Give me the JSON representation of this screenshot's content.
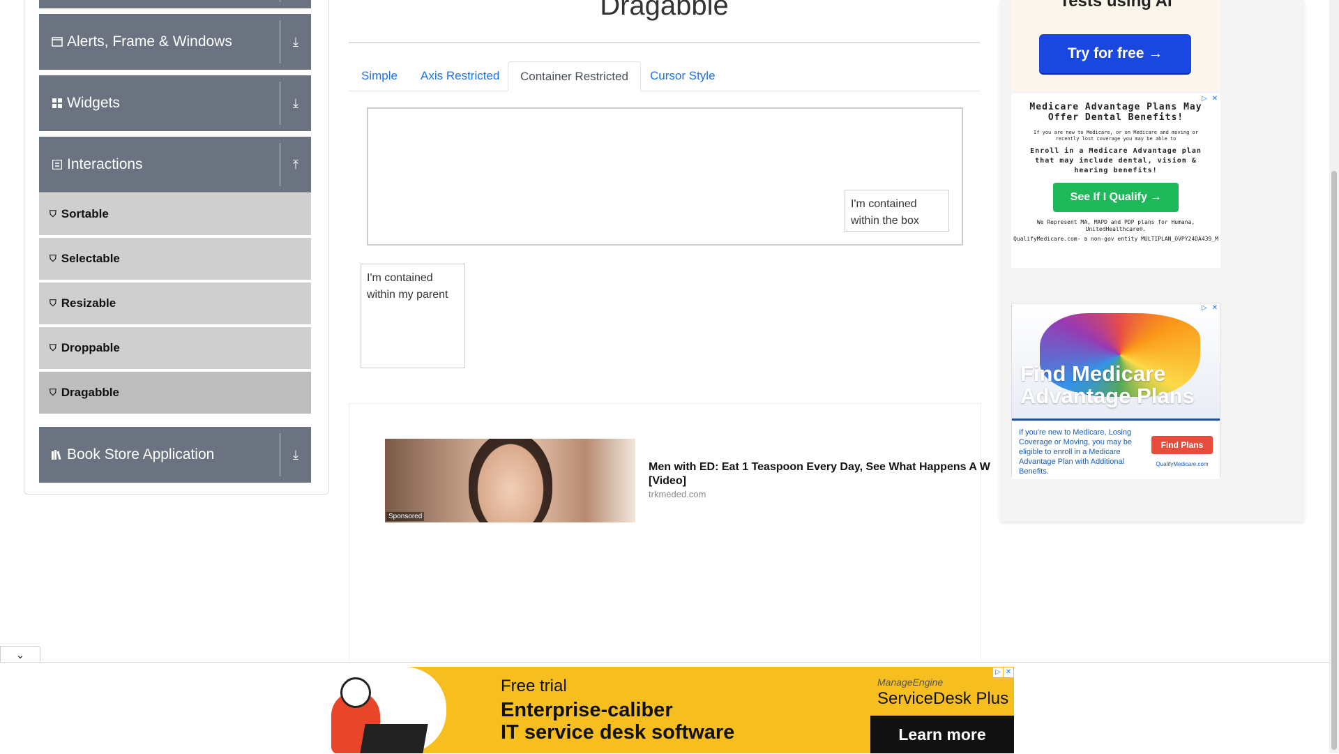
{
  "sidebar": {
    "groups": [
      {
        "label": "Alerts, Frame & Windows",
        "icon": "window-icon",
        "toggle": "download-arrow-icon"
      },
      {
        "label": "Widgets",
        "icon": "grid-icon",
        "toggle": "download-arrow-icon"
      },
      {
        "label": "Interactions",
        "icon": "interaction-icon",
        "toggle": "upload-arrow-icon"
      },
      {
        "label": "Book Store Application",
        "icon": "books-icon",
        "toggle": "download-arrow-icon"
      }
    ],
    "items": [
      {
        "label": "Sortable"
      },
      {
        "label": "Selectable"
      },
      {
        "label": "Resizable"
      },
      {
        "label": "Droppable"
      },
      {
        "label": "Dragabble"
      }
    ]
  },
  "main": {
    "title": "Dragabble",
    "tabs": [
      {
        "label": "Simple"
      },
      {
        "label": "Axis Restricted"
      },
      {
        "label": "Container Restricted"
      },
      {
        "label": "Cursor Style"
      }
    ],
    "box_drag_text": "I'm contained within the box",
    "parent_drag_text": "I'm contained within my parent"
  },
  "sponsored": {
    "tag": "Sponsored",
    "title": "Men with ED: Eat 1 Teaspoon Every Day, See What Happens A W [Video]",
    "domain": "trkmeded.com"
  },
  "ads": {
    "ai_text": "Tests using AI",
    "ai_button": "Try for free →",
    "medicare1": {
      "heading": "Medicare Advantage Plans May Offer Dental Benefits!",
      "small": "If you are new to Medicare, or on Medicare and moving or recently lost coverage you may be able to",
      "main": "Enroll in a Medicare Advantage plan that may include dental, vision & hearing benefits!",
      "button": "See If I Qualify →",
      "footer1": "We Represent MA, MAPD and PDP plans for Humana, UnitedHealthcare®.",
      "footer2": "QualifyMedicare.com- a non-gov entity MULTIPLAN_OVPY24DA439_M"
    },
    "medicare2": {
      "title": "Find Medicare Advantage Plans",
      "desc": "If you're new to Medicare, Losing Coverage or Moving, you may be eligible to enroll in a Medicare Advantage Plan with Additional Benefits.",
      "button": "Find Plans",
      "source": "QualifyMedicare.com"
    },
    "banner": {
      "small": "Free trial",
      "line1": "Enterprise-caliber",
      "line2": "IT service desk software",
      "brand1": "ManageEngine",
      "brand2": "ServiceDesk Plus",
      "cta": "Learn more"
    }
  }
}
